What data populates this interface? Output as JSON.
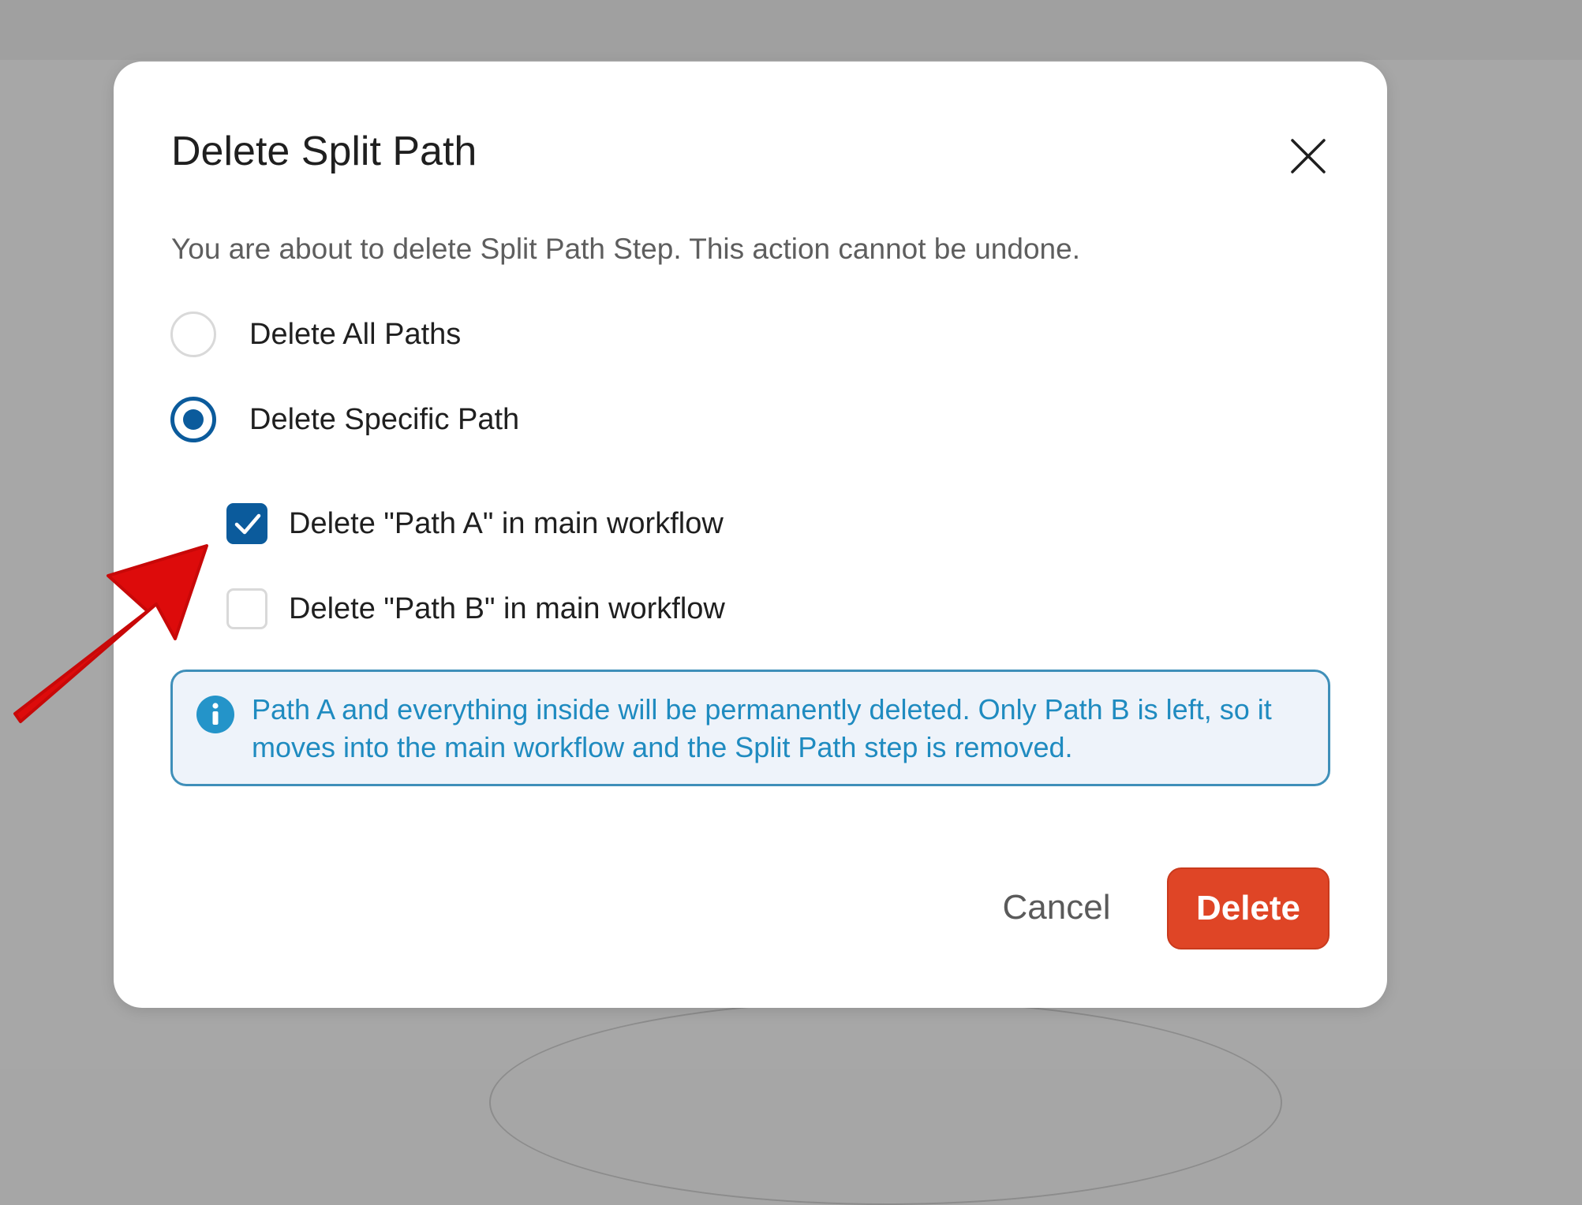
{
  "dialog": {
    "title": "Delete Split Path",
    "description": "You are about to delete Split Path Step. This action cannot be undone.",
    "close_icon": "close-icon"
  },
  "options": [
    {
      "label": "Delete All Paths",
      "selected": false
    },
    {
      "label": "Delete Specific Path",
      "selected": true
    }
  ],
  "paths": [
    {
      "label": "Delete \"Path A\" in main workflow",
      "checked": true
    },
    {
      "label": "Delete \"Path B\" in main workflow",
      "checked": false
    }
  ],
  "info": {
    "icon": "info-icon",
    "text": "Path A and everything inside will be permanently deleted. Only Path B is left, so it moves into the main workflow and the Split Path step is removed."
  },
  "buttons": {
    "cancel": "Cancel",
    "delete": "Delete"
  },
  "colors": {
    "primary": "#0b5b9c",
    "danger": "#df4526",
    "info_text": "#1f8bc0",
    "info_border": "#3f8fb9",
    "info_bg": "#eef3fa",
    "annotation_arrow": "#dd0b0b"
  }
}
